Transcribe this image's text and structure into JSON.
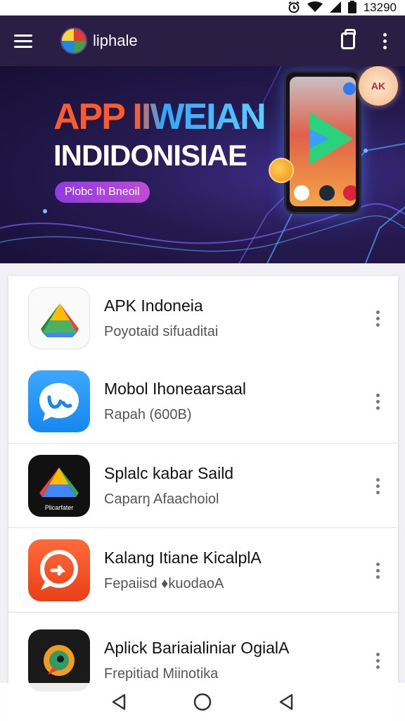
{
  "status_bar": {
    "time": "13290"
  },
  "app_bar": {
    "title": "liphale"
  },
  "banner": {
    "headline": "APP IIWEIAN",
    "subheadline": "INDIDONISIAE",
    "pill_label": "Plobc Ih Bneoil",
    "badge_text": "AK"
  },
  "apps": [
    {
      "name": "APK Indoneia",
      "subtitle": "Poyotaid sifuaditai",
      "icon": "drive-icon"
    },
    {
      "name": "Mobol Ihoneaarsaal",
      "subtitle": "Rapah  (600B)",
      "icon": "chat-bubble-icon"
    },
    {
      "name": "Splalc kabar Saild",
      "subtitle": "Caparŋ Afaachoiol",
      "icon": "drive-dark-icon",
      "icon_caption": "Plicarfater"
    },
    {
      "name": "Kalang Itiane KicalplA",
      "subtitle": "Fepaiisd ♦kuodaoA",
      "icon": "message-icon"
    },
    {
      "name": "Aplick Bariaialiniar OgialA",
      "subtitle": "Frepitiad Miinotika",
      "icon": "rocket-icon"
    }
  ],
  "colors": {
    "app_bar": "#2a1e44",
    "accent_orange": "#ff5a2c",
    "accent_blue": "#33a6ff"
  }
}
